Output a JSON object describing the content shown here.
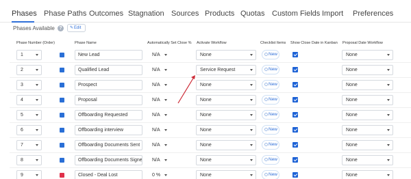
{
  "tabs": [
    {
      "label": "Phases",
      "active": true
    },
    {
      "label": "Phase Paths",
      "active": false
    },
    {
      "label": "Outcomes",
      "active": false
    },
    {
      "label": "Stagnation",
      "active": false
    },
    {
      "label": "Sources",
      "active": false
    },
    {
      "label": "Products",
      "active": false
    },
    {
      "label": "Quotas",
      "active": false
    },
    {
      "label": "Custom Fields",
      "active": false
    },
    {
      "label": "Import",
      "active": false
    },
    {
      "label": "Preferences",
      "active": false
    }
  ],
  "phases_available": {
    "label": "Phases Available",
    "help_icon": "?",
    "edit_label": "Edit",
    "edit_icon": "pencil-icon"
  },
  "columns": {
    "phase_number": "Phase Number (Order)",
    "phase_name": "Phase Name",
    "auto_close": "Automatically Set Close %",
    "activate_workflow": "Activate Workflow",
    "checklist_items": "Checklist Items",
    "show_close_date": "Show Close Date in Kanban",
    "proposal_workflow": "Proposal Date Workflow"
  },
  "colors": {
    "accent": "#2f6fd8",
    "checkbox": "#1e63d6",
    "swatch_blue": "#2a6fd6",
    "swatch_red": "#e0304a",
    "arrow": "#cc2a36"
  },
  "new_label": "New",
  "rows": [
    {
      "number": "1",
      "color": "blue",
      "name": "New Lead",
      "close_pct": "N/A",
      "workflow": "None",
      "show_close_date": true,
      "proposal": "None"
    },
    {
      "number": "2",
      "color": "blue",
      "name": "Qualified Lead",
      "close_pct": "N/A",
      "workflow": "Service Request",
      "show_close_date": true,
      "proposal": "None"
    },
    {
      "number": "3",
      "color": "blue",
      "name": "Prospect",
      "close_pct": "N/A",
      "workflow": "None",
      "show_close_date": true,
      "proposal": "None"
    },
    {
      "number": "4",
      "color": "blue",
      "name": "Proposal",
      "close_pct": "N/A",
      "workflow": "None",
      "show_close_date": true,
      "proposal": "None"
    },
    {
      "number": "5",
      "color": "blue",
      "name": "Offboarding Requested",
      "close_pct": "N/A",
      "workflow": "None",
      "show_close_date": true,
      "proposal": "None"
    },
    {
      "number": "6",
      "color": "blue",
      "name": "Offboarding interview",
      "close_pct": "N/A",
      "workflow": "None",
      "show_close_date": true,
      "proposal": "None"
    },
    {
      "number": "7",
      "color": "blue",
      "name": "Offboarding Documents Sent",
      "close_pct": "N/A",
      "workflow": "None",
      "show_close_date": true,
      "proposal": "None"
    },
    {
      "number": "8",
      "color": "blue",
      "name": "Offboarding Documents Signed",
      "close_pct": "N/A",
      "workflow": "None",
      "show_close_date": true,
      "proposal": "None"
    },
    {
      "number": "9",
      "color": "red",
      "name": "Closed - Deal Lost",
      "close_pct": "0 %",
      "workflow": "None",
      "show_close_date": true,
      "proposal": "None"
    }
  ]
}
